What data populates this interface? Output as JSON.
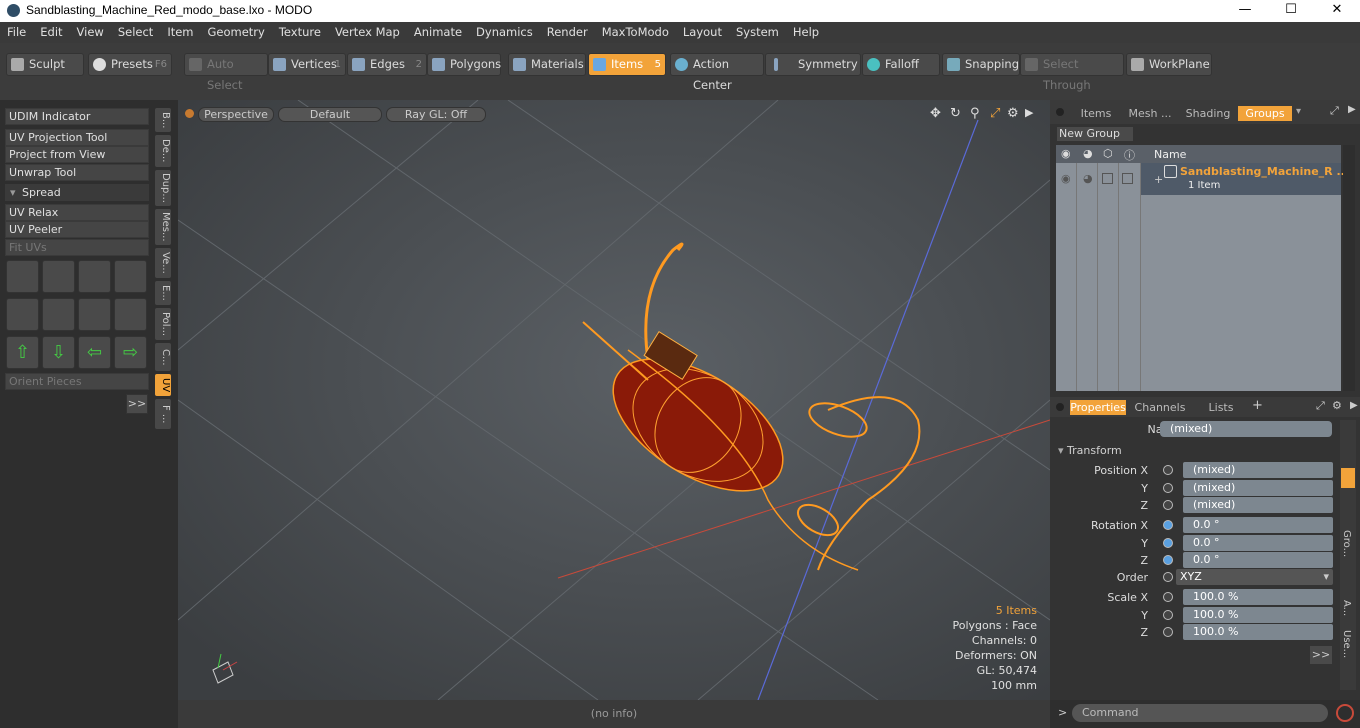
{
  "window": {
    "title": "Sandblasting_Machine_Red_modo_base.lxo - MODO",
    "minimize": "—",
    "maximize": "☐",
    "close": "✕"
  },
  "menu": [
    "File",
    "Edit",
    "View",
    "Select",
    "Item",
    "Geometry",
    "Texture",
    "Vertex Map",
    "Animate",
    "Dynamics",
    "Render",
    "MaxToModo",
    "Layout",
    "System",
    "Help"
  ],
  "toolbar": {
    "sculpt": "Sculpt",
    "presets": "Presets",
    "presets_key": "F6",
    "auto_select": "Auto Select",
    "vertices": "Vertices",
    "vertices_num": "1",
    "edges": "Edges",
    "edges_num": "2",
    "polygons": "Polygons",
    "materials": "Materials",
    "items": "Items",
    "items_num": "5",
    "action_center": "Action Center",
    "symmetry": "Symmetry",
    "falloff": "Falloff",
    "snapping": "Snapping",
    "select_through": "Select Through",
    "workplane": "WorkPlane"
  },
  "left": {
    "items": [
      "UDIM Indicator",
      "UV Projection Tool",
      "Project from View",
      "Unwrap Tool"
    ],
    "spread": "Spread",
    "items2": [
      "UV Relax",
      "UV Peeler"
    ],
    "fit_uvs": "Fit UVs",
    "orient": "Orient Pieces",
    "more": ">>",
    "vtabs": [
      "B...",
      "De...",
      "Dup...",
      "Mes...",
      "Ve...",
      "E...",
      "Pol...",
      "C...",
      "UV",
      "F ..."
    ]
  },
  "viewport": {
    "perspective": "Perspective",
    "default": "Default",
    "raygl": "Ray GL: Off",
    "items_count": "5 Items",
    "polygons": "Polygons : Face",
    "channels": "Channels: 0",
    "deformers": "Deformers: ON",
    "gl": "GL: 50,474",
    "scale": "100 mm"
  },
  "status": "(no info)",
  "right": {
    "tabs": [
      "Items",
      "Mesh ...",
      "Shading",
      "Groups"
    ],
    "new_group": "New Group",
    "col_name": "Name",
    "group_name": "Sandblasting_Machine_R ...",
    "group_count": "1 Item",
    "props_tabs": [
      "Properties",
      "Channels",
      "Lists"
    ],
    "name_label": "Name",
    "name_value": "(mixed)",
    "transform": "Transform",
    "position_x": "Position X",
    "y": "Y",
    "z": "Z",
    "pos_vals": [
      "(mixed)",
      "(mixed)",
      "(mixed)"
    ],
    "rotation_x": "Rotation X",
    "rot_vals": [
      "0.0 °",
      "0.0 °",
      "0.0 °"
    ],
    "order": "Order",
    "order_val": "XYZ",
    "scale_x": "Scale X",
    "scale_vals": [
      "100.0 %",
      "100.0 %",
      "100.0 %"
    ],
    "more": ">>",
    "command": "Command",
    "side_tabs": [
      "Gro...",
      "A...",
      "Use..."
    ]
  }
}
